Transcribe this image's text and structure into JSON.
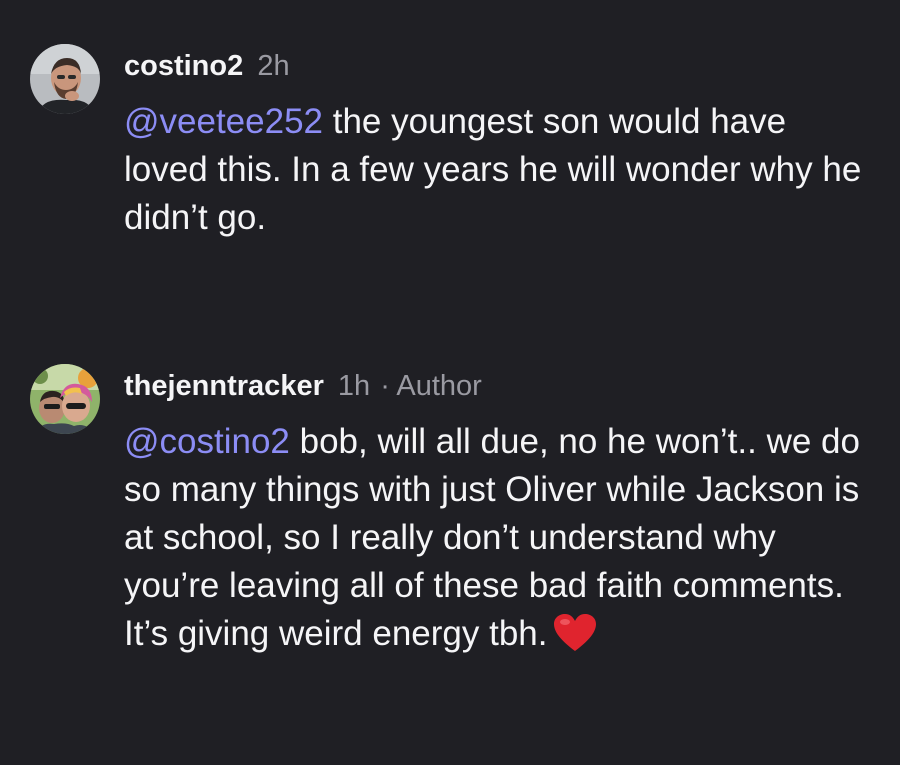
{
  "comments": [
    {
      "username": "costino2",
      "time": "2h",
      "author_label": "",
      "mention": "@veetee252",
      "text": " the youngest son would have loved this. In a few years he will wonder why he didn’t go.",
      "avatar_icon": "profile-photo-man-with-beard",
      "emoji": ""
    },
    {
      "username": "thejenntracker",
      "time": "1h",
      "author_label": "· Author",
      "mention": "@costino2",
      "text": " bob, will all due, no he won’t.. we do so many things with just Oliver while Jackson is at school, so I really don’t understand why you’re leaving all of these bad faith comments. It’s giving weird energy tbh.",
      "avatar_icon": "profile-photo-couple-selfie",
      "emoji": "red-heart-icon"
    }
  ],
  "colors": {
    "background": "#1f1f24",
    "text": "#f5f5f7",
    "meta": "#9a9aa2",
    "mention": "#8c8df5",
    "heart": "#e0242e"
  }
}
